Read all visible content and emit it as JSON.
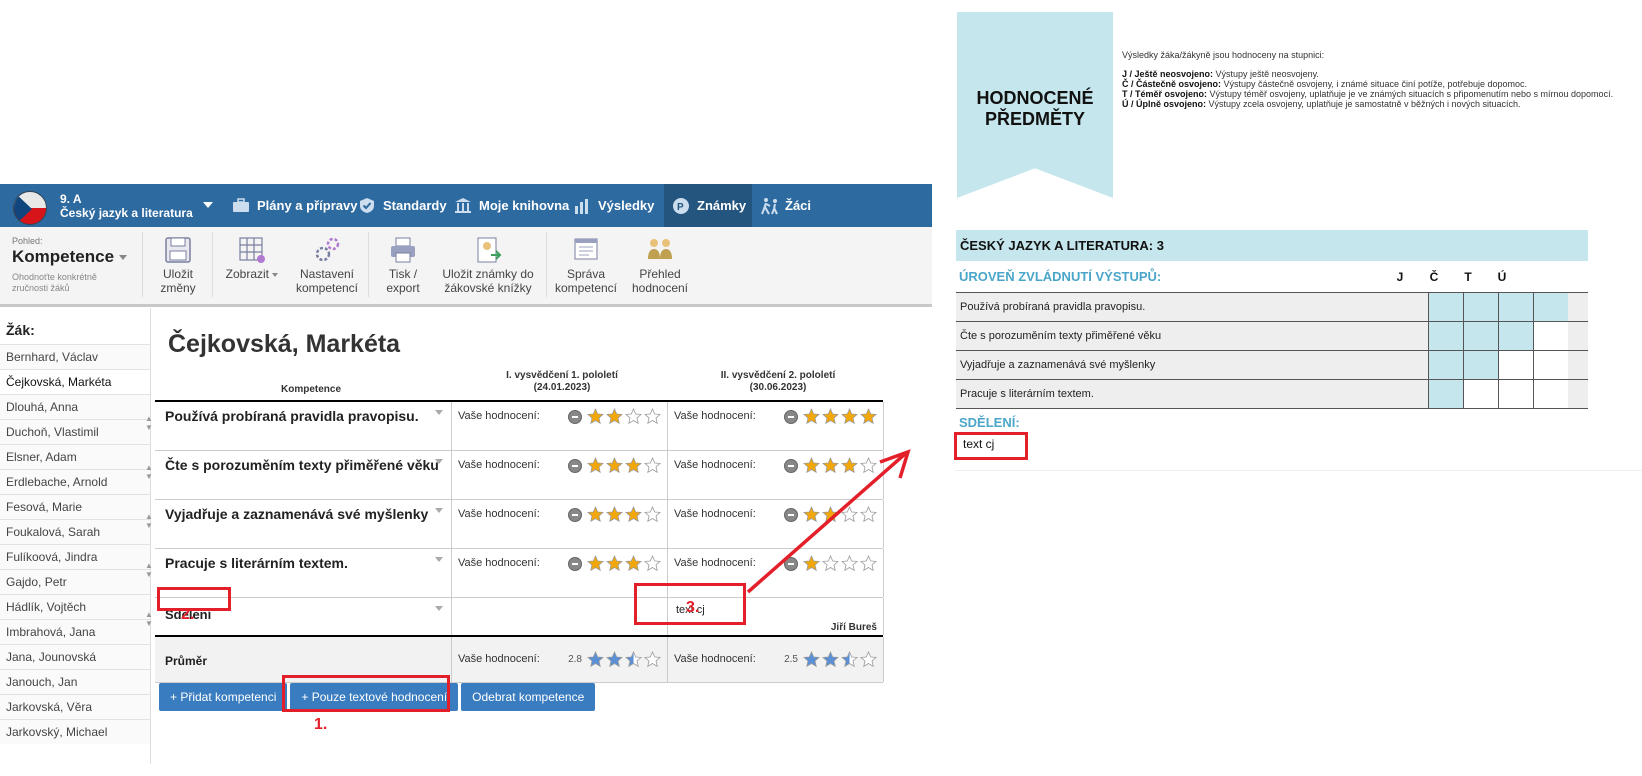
{
  "app": {
    "class_name": "9. A",
    "subject": "Český jazyk a literatura",
    "nav": [
      "Plány a přípravy",
      "Standardy",
      "Moje knihovna",
      "Výsledky",
      "Známky",
      "Žáci"
    ],
    "pohled_small": "Pohled:",
    "pohled_value": "Kompetence",
    "pohled_hint": "Ohodnoťte konkrétně zručnosti žáků",
    "toolbar": {
      "save": [
        "Uložit",
        "změny"
      ],
      "show": "Zobrazit",
      "settings": [
        "Nastavení",
        "kompetencí"
      ],
      "print": [
        "Tisk /",
        "export"
      ],
      "save_book": [
        "Uložit známky do",
        "žákovské knížky"
      ],
      "manage": [
        "Správa",
        "kompetencí"
      ],
      "overview": [
        "Přehled",
        "hodnocení"
      ]
    },
    "sidebar_title": "Žák:",
    "students": [
      "Bernhard, Václav",
      "Čejkovská, Markéta",
      "Dlouhá, Anna",
      "Duchoň, Vlastimil",
      "Elsner, Adam",
      "Erdlebache, Arnold",
      "Fesová, Marie",
      "Foukalová, Sarah",
      "Fulíkoová, Jindra",
      "Gajdo, Petr",
      "Hádlík, Vojtěch",
      "Imbrahová, Jana",
      "Jana, Jounovská",
      "Janouch, Jan",
      "Jarkovská, Věra",
      "Jarkovský, Michael"
    ],
    "selected_student": "Čejkovská, Markéta",
    "col_comp": "Kompetence",
    "col1": [
      "I. vysvědčení 1. pololetí",
      "(24.01.2023)"
    ],
    "col2": [
      "II. vysvědčení 2. pololetí",
      "(30.06.2023)"
    ],
    "rating_label": "Vaše hodnocení:",
    "competences": [
      {
        "name": "Používá probíraná pravidla pravopisu.",
        "r1": 2,
        "r2": 4
      },
      {
        "name": "Čte s porozuměním texty přiměřené věku",
        "r1": 3,
        "r2": 3
      },
      {
        "name": "Vyjadřuje a zaznamenává své myšlenky",
        "r1": 3,
        "r2": 2
      },
      {
        "name": "Pracuje s literárním textem.",
        "r1": 3,
        "r2": 1
      }
    ],
    "sdeleni_label": "Sdělení",
    "sdeleni_text": "text cj",
    "teacher": "Jiří Bureš",
    "avg_label": "Průměr",
    "avg1": "2.8",
    "avg2": "2.5",
    "avg1_fill": 2.5,
    "avg2_fill": 2.5,
    "buttons": [
      "+ Přidat kompetenci",
      "+ Pouze textové hodnocení",
      "Odebrat kompetence"
    ],
    "markers": [
      "1.",
      "2.",
      "3."
    ]
  },
  "report": {
    "ribbon": [
      "HODNOCENÉ",
      "PŘEDMĚTY"
    ],
    "legend_intro": "Výsledky žáka/žákyně jsou hodnoceny na stupnici:",
    "legend": [
      {
        "k": "J / Ještě neosvojeno:",
        "v": " Výstupy ještě neosvojeny."
      },
      {
        "k": "Č / Částečně osvojeno:",
        "v": " Výstupy částečně osvojeny, i známé situace činí potíže, potřebuje dopomoc."
      },
      {
        "k": "T / Téměř osvojeno:",
        "v": " Výstupy téměř osvojeny, uplatňuje je ve známých situacích s připomenutím nebo s mírnou dopomocí."
      },
      {
        "k": "Ú / Úplně osvojeno:",
        "v": " Výstupy zcela osvojeny, uplatňuje je samostatně v běžných i nových situacích."
      }
    ],
    "subject_title": "ČESKÝ JAZYK A LITERATURA: 3",
    "uroven_label": "ÚROVEŇ ZVLÁDNUTÍ VÝSTUPŮ:",
    "letters": [
      "J",
      "Č",
      "T",
      "Ú"
    ],
    "rows": [
      {
        "text": "Používá probíraná pravidla pravopisu.",
        "level": 4
      },
      {
        "text": "Čte s porozuměním texty přiměřené věku",
        "level": 3
      },
      {
        "text": "Vyjadřuje a zaznamenává své myšlenky",
        "level": 2
      },
      {
        "text": "Pracuje s literárním textem.",
        "level": 1
      }
    ],
    "sdeleni_label": "SDĚLENÍ:",
    "sdeleni_text": "text cj"
  },
  "colors": {
    "nav": "#2d6aa0",
    "star": "#f2a80b",
    "avg_star": "#5b8fd6",
    "highlight": "#e3202a",
    "report_fill": "#c5e6ec"
  }
}
